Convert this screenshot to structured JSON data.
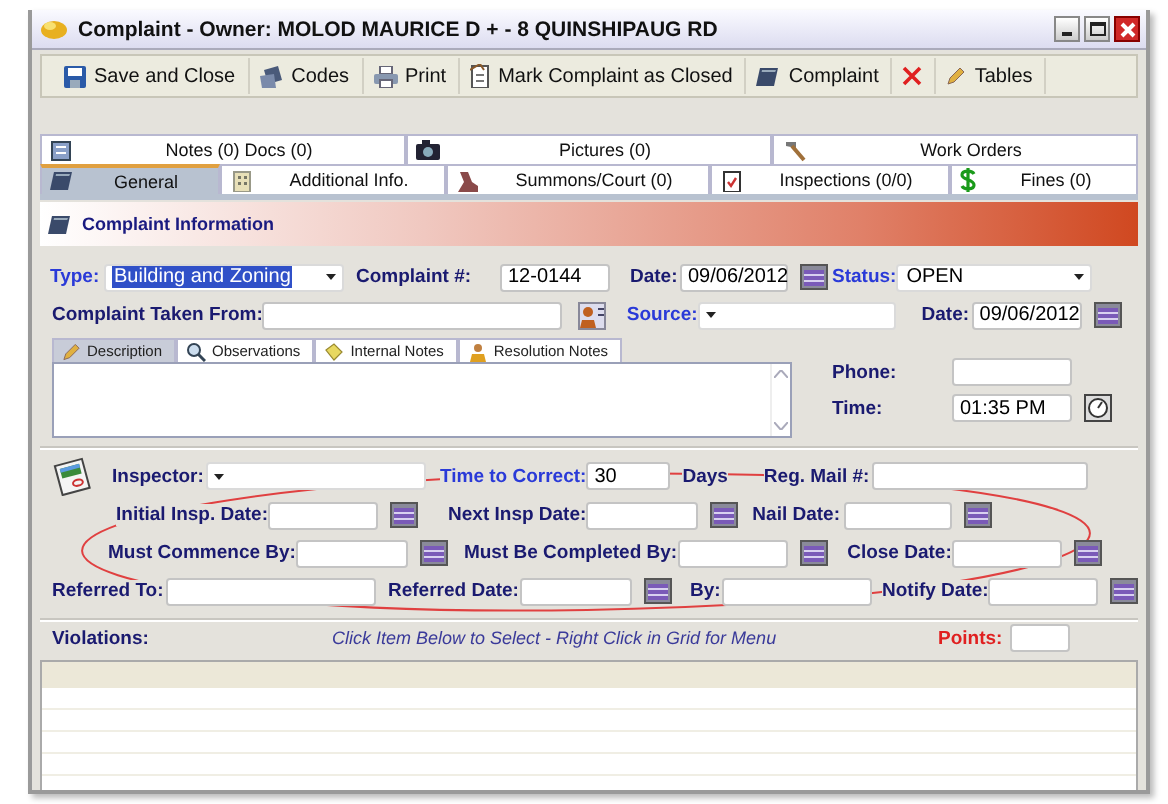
{
  "window": {
    "title": "Complaint - Owner: MOLOD MAURICE D + - 8 QUINSHIPAUG RD"
  },
  "toolbar": [
    {
      "kind": "save",
      "label": "Save and Close"
    },
    {
      "kind": "codes",
      "label": "Codes"
    },
    {
      "kind": "print",
      "label": "Print"
    },
    {
      "kind": "mark",
      "label": "Mark Complaint as Closed"
    },
    {
      "kind": "book",
      "label": "Complaint"
    },
    {
      "kind": "delete"
    },
    {
      "kind": "tables",
      "label": "Tables"
    }
  ],
  "tab_rows": [
    [
      {
        "label": "Notes (0) Docs (0)",
        "selected": false
      },
      {
        "label": "Pictures (0)",
        "selected": false
      },
      {
        "label": "Work Orders",
        "selected": false
      }
    ],
    [
      {
        "label": "General",
        "selected": true
      },
      {
        "label": "Additional Info.",
        "selected": false
      },
      {
        "label": "Summons/Court (0)",
        "selected": false
      },
      {
        "label": "Inspections (0/0)",
        "selected": false
      },
      {
        "label": "Fines (0)",
        "selected": false
      }
    ]
  ],
  "section_title": "Complaint Information",
  "rows": [
    [
      {
        "label": "Type:",
        "kind": "dropdown",
        "link": true,
        "value": "Building and Zoning",
        "highlighted": true
      },
      {
        "label": "Complaint #:",
        "kind": "text",
        "value": "12-0144"
      },
      {
        "label": "Date:",
        "kind": "date",
        "value": "09/06/2012"
      },
      {
        "label": "Status:",
        "kind": "dropdown",
        "link": true,
        "value": "OPEN"
      }
    ],
    [
      {
        "label": "Complaint Taken From:",
        "kind": "contact"
      },
      {
        "label": "Source:",
        "kind": "dropdown",
        "link": true
      },
      {
        "label": "Date:",
        "kind": "date",
        "value": "09/06/2012"
      }
    ],
    [
      {
        "label": "Inspector:",
        "kind": "dropdown"
      },
      {
        "label": "Time to Correct:",
        "kind": "text",
        "link": true,
        "value": "30",
        "unit": "Days"
      },
      {
        "label": "Reg. Mail #:",
        "kind": "text"
      }
    ],
    [
      {
        "label": "Initial Insp. Date:",
        "kind": "date"
      },
      {
        "label": "Next Insp Date:",
        "kind": "date"
      },
      {
        "label": "Nail Date:",
        "kind": "date"
      }
    ],
    [
      {
        "label": "Must Commence By:",
        "kind": "date"
      },
      {
        "label": "Must Be Completed By:",
        "kind": "date"
      },
      {
        "label": "Close Date:",
        "kind": "date"
      }
    ],
    [
      {
        "label": "Referred To:",
        "kind": "text"
      },
      {
        "label": "Referred Date:",
        "kind": "date"
      },
      {
        "label": "By:",
        "kind": "text"
      },
      {
        "label": "Notify Date:",
        "kind": "date"
      }
    ]
  ],
  "note_tabs": [
    {
      "label": "Description",
      "selected": true
    },
    {
      "label": "Observations",
      "selected": false
    },
    {
      "label": "Internal Notes",
      "selected": false
    },
    {
      "label": "Resolution Notes",
      "selected": false
    }
  ],
  "side_fields": [
    {
      "label": "Phone:",
      "kind": "text"
    },
    {
      "label": "Time:",
      "kind": "time",
      "value": "01:35 PM"
    }
  ],
  "violations": {
    "label": "Violations:",
    "hint": "Click Item Below to Select - Right Click in Grid for Menu",
    "points_label": "Points:"
  }
}
